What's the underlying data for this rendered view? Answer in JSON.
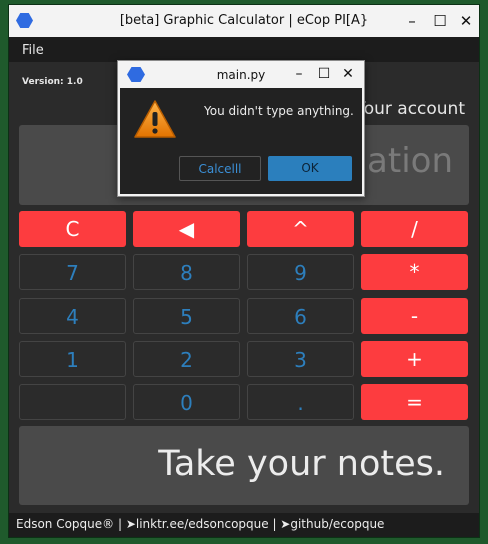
{
  "window": {
    "title": "[beta] Graphic Calculator | eCop PI[A}",
    "icon_text": "eCop PIA"
  },
  "menu": {
    "file": "File"
  },
  "version": "Version: 1.0",
  "account": "Your account",
  "display": {
    "placeholder": "Enter your equation"
  },
  "keypad": [
    [
      "C",
      "◀",
      "^",
      "/"
    ],
    [
      "7",
      "8",
      "9",
      "*"
    ],
    [
      "4",
      "5",
      "6",
      "-"
    ],
    [
      "1",
      "2",
      "3",
      "+"
    ],
    [
      "",
      "0",
      ".",
      "="
    ]
  ],
  "notes": {
    "placeholder": "Take your notes."
  },
  "footer": "Edson Copque® | ➤linktr.ee/edsoncopque | ➤github/ecopque",
  "dialog": {
    "title": "main.py",
    "message": "You didn't type anything.",
    "cancel_label": "Calcelll",
    "ok_label": "OK"
  },
  "colors": {
    "accent_red": "#fd3c3f",
    "accent_blue": "#2b7fbd"
  }
}
